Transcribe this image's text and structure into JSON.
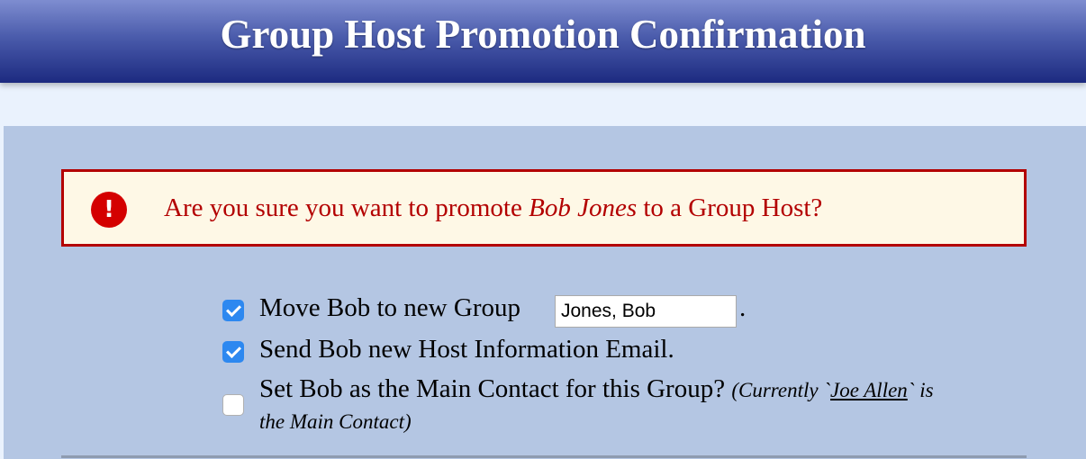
{
  "header": {
    "title": "Group Host Promotion Confirmation"
  },
  "alert": {
    "icon": "exclamation-icon",
    "icon_glyph": "!",
    "text_before": "Are you sure you want to promote ",
    "member_name": "Bob Jones",
    "text_after": " to a Group Host?",
    "color": "#b30000"
  },
  "options": {
    "move_group": {
      "checked": true,
      "label": "Move Bob to new Group",
      "group_value": "Jones, Bob",
      "period": "."
    },
    "send_email": {
      "checked": true,
      "label": "Send Bob new Host Information Email."
    },
    "main_contact": {
      "checked": false,
      "label": "Set Bob as the Main Contact for this Group?",
      "note_prefix": "(Currently `",
      "current_contact": "Joe Allen",
      "note_suffix_line1": "` is",
      "note_line2": "the Main Contact)"
    }
  },
  "colors": {
    "header_top": "#7e8dd0",
    "header_bottom": "#1c2a80",
    "panel": "#b4c6e3",
    "checkbox_checked": "#2d88f0"
  }
}
